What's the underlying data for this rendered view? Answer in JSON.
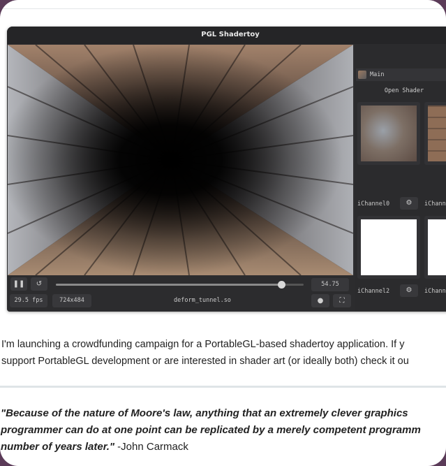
{
  "window": {
    "title": "PGL Shadertoy"
  },
  "controls": {
    "pause_icon": "pause-icon",
    "restart_icon": "restart-icon",
    "time": "54.75",
    "progress": 0.91,
    "fps": "29.5 fps",
    "resolution": "724x484",
    "filename": "deform_tunnel.so",
    "record_icon": "record-icon",
    "fullscreen_icon": "fullscreen-icon"
  },
  "sidebar": {
    "main_tab": "Main",
    "open_shader": "Open Shader",
    "channels": [
      {
        "label": "iChannel0"
      },
      {
        "label": "iChann"
      },
      {
        "label": "iChannel2"
      },
      {
        "label": "iChann"
      }
    ]
  },
  "article": {
    "para_line1": "I'm launching a crowdfunding campaign for a PortableGL-based shadertoy application. If y",
    "para_line2": "support PortableGL development or are interested in shader art (or ideally both) check it ou",
    "quote_line1": "\"Because of the nature of Moore's law, anything that an extremely clever graphics",
    "quote_line2": "programmer can do at one point can be replicated by a merely competent programm",
    "quote_line3_bold": "number of years later.\"",
    "quote_attrib": " -John Carmack"
  },
  "colors": {
    "window_bg": "#2f2f31",
    "page_bg": "#ffffff",
    "outer_bg": "#5b3b58"
  }
}
